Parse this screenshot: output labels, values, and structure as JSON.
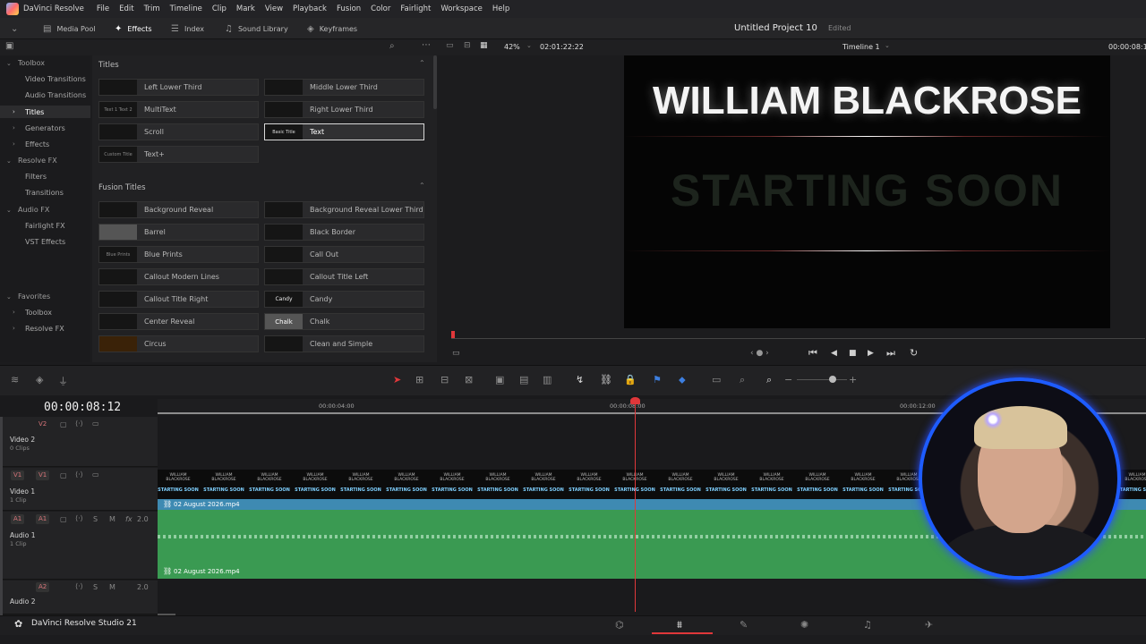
{
  "menubar": {
    "app_name": "DaVinci Resolve",
    "items": [
      "File",
      "Edit",
      "Trim",
      "Timeline",
      "Clip",
      "Mark",
      "View",
      "Playback",
      "Fusion",
      "Color",
      "Fairlight",
      "Workspace",
      "Help"
    ]
  },
  "toolbar": {
    "media_pool": "Media Pool",
    "effects": "Effects",
    "index": "Index",
    "sound_library": "Sound Library",
    "keyframes": "Keyframes"
  },
  "project": {
    "title": "Untitled Project 10",
    "status": "Edited"
  },
  "viewer_bar": {
    "zoom": "42%",
    "timecode": "02:01:22:22",
    "timeline_name": "Timeline 1",
    "timecode_right": "00:00:08:1"
  },
  "left_nav": {
    "toolbox": "Toolbox",
    "video_transitions": "Video Transitions",
    "audio_transitions": "Audio Transitions",
    "titles": "Titles",
    "generators": "Generators",
    "effects": "Effects",
    "resolve_fx": "Resolve FX",
    "filters": "Filters",
    "transitions": "Transitions",
    "audio_fx": "Audio FX",
    "fairlight_fx": "Fairlight FX",
    "vst_effects": "VST Effects",
    "favorites": "Favorites",
    "fav_toolbox": "Toolbox",
    "fav_resolve_fx": "Resolve FX"
  },
  "effects_panel": {
    "titles_header": "Titles",
    "titles": [
      {
        "label": "Left Lower Third",
        "thumb": ""
      },
      {
        "label": "Middle Lower Third",
        "thumb": ""
      },
      {
        "label": "MultiText",
        "thumb": "Text 1 Text 2"
      },
      {
        "label": "Right Lower Third",
        "thumb": ""
      },
      {
        "label": "Scroll",
        "thumb": ""
      },
      {
        "label": "Text",
        "thumb": "Basic Title"
      },
      {
        "label": "Text+",
        "thumb": "Custom Title"
      }
    ],
    "fusion_header": "Fusion Titles",
    "fusion_titles": [
      {
        "label": "Background Reveal",
        "thumb": ""
      },
      {
        "label": "Background Reveal Lower Third",
        "thumb": ""
      },
      {
        "label": "Barrel",
        "thumb": ""
      },
      {
        "label": "Black Border",
        "thumb": ""
      },
      {
        "label": "Blue Prints",
        "thumb": "Blue Prints"
      },
      {
        "label": "Call Out",
        "thumb": ""
      },
      {
        "label": "Callout Modern Lines",
        "thumb": ""
      },
      {
        "label": "Callout Title Left",
        "thumb": ""
      },
      {
        "label": "Callout Title Right",
        "thumb": ""
      },
      {
        "label": "Candy",
        "thumb": "Candy"
      },
      {
        "label": "Center Reveal",
        "thumb": ""
      },
      {
        "label": "Chalk",
        "thumb": "Chalk"
      },
      {
        "label": "Circus",
        "thumb": ""
      },
      {
        "label": "Clean and Simple",
        "thumb": ""
      }
    ]
  },
  "viewer": {
    "headline": "WILLIAM BLACKROSE",
    "subline": "STARTING SOON"
  },
  "timeline": {
    "timecode": "00:00:08:12",
    "ruler_labels": [
      "00:00:04:00",
      "00:00:08:00",
      "00:00:12:00"
    ],
    "tracks": {
      "v2": {
        "badge": "V2",
        "name": "Video 2",
        "sub": "0 Clips"
      },
      "v1": {
        "badge_src": "V1",
        "badge": "V1",
        "name": "Video 1",
        "sub": "1 Clip"
      },
      "a1": {
        "badge_src": "A1",
        "badge": "A1",
        "name": "Audio 1",
        "sub": "1 Clip",
        "vol": "2.0",
        "fx": "fx"
      },
      "a2": {
        "badge": "A2",
        "name": "Audio 2",
        "vol": "2.0"
      }
    },
    "clip_name": "02 August 2026.mp4",
    "thumb_headline": "WILLIAM BLACKROSE",
    "thumb_sub": "STARTING SOON"
  },
  "bottom": {
    "brand": "DaVinci Resolve Studio 21"
  }
}
